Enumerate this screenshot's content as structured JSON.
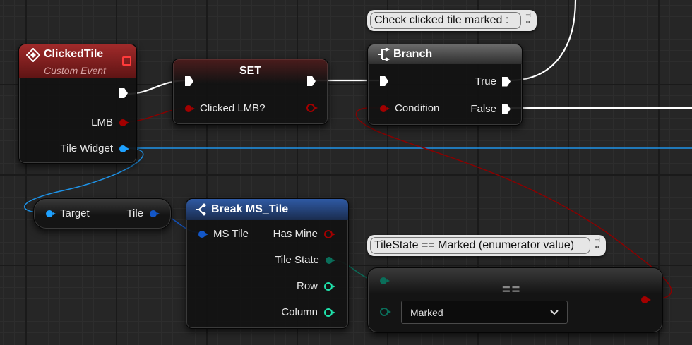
{
  "colors": {
    "exec": "#ffffff",
    "bool": "#9b0000",
    "object": "#1ea1ff",
    "struct": "#1357c8",
    "enum": "#0a6e5a",
    "int": "#1fe3ac",
    "event_header": "#7e1a1a",
    "branch_header": "#4b4b4b",
    "break_header": "#23447e"
  },
  "event_node": {
    "title": "ClickedTile",
    "subtitle": "Custom Event",
    "icon": "event-diamond-icon",
    "pins": [
      {
        "label": "",
        "type": "exec"
      },
      {
        "label": "LMB",
        "type": "bool"
      },
      {
        "label": "Tile Widget",
        "type": "object"
      }
    ]
  },
  "set_node": {
    "title": "SET",
    "input_label": "Clicked LMB?"
  },
  "branch_node": {
    "comment": "Check clicked tile marked :",
    "title": "Branch",
    "icon": "branch-icon",
    "condition_label": "Condition",
    "true_label": "True",
    "false_label": "False"
  },
  "getter_node": {
    "input_label": "Target",
    "output_label": "Tile"
  },
  "break_node": {
    "title": "Break MS_Tile",
    "icon": "break-struct-icon",
    "input_label": "MS Tile",
    "outputs": [
      {
        "label": "Has Mine",
        "type": "bool"
      },
      {
        "label": "Tile State",
        "type": "enum"
      },
      {
        "label": "Row",
        "type": "int"
      },
      {
        "label": "Column",
        "type": "int"
      }
    ]
  },
  "equal_node": {
    "comment": "TileState == Marked (enumerator value)",
    "operator": "==",
    "dropdown_value": "Marked"
  }
}
